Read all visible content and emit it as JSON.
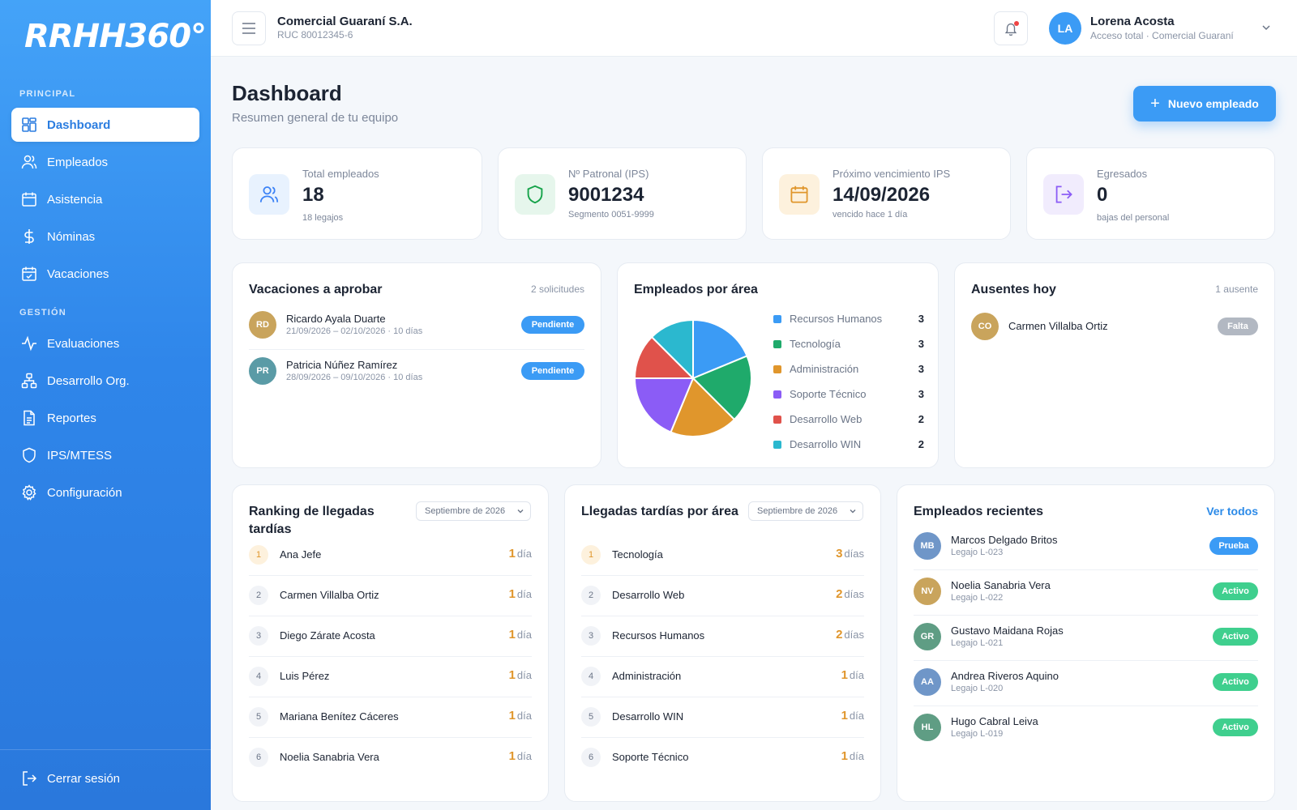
{
  "app": {
    "logo": "RRHH360°"
  },
  "sidebar": {
    "section_principal": "PRINCIPAL",
    "section_gestion": "GESTIÓN",
    "items": [
      {
        "label": "Dashboard",
        "icon": "dashboard-icon"
      },
      {
        "label": "Empleados",
        "icon": "users-icon"
      },
      {
        "label": "Asistencia",
        "icon": "calendar-icon"
      },
      {
        "label": "Nóminas",
        "icon": "dollar-icon"
      },
      {
        "label": "Vacaciones",
        "icon": "calendar-check-icon"
      },
      {
        "label": "Evaluaciones",
        "icon": "activity-icon"
      },
      {
        "label": "Desarrollo Org.",
        "icon": "org-chart-icon"
      },
      {
        "label": "Reportes",
        "icon": "document-icon"
      },
      {
        "label": "IPS/MTESS",
        "icon": "shield-icon"
      },
      {
        "label": "Configuración",
        "icon": "gear-icon"
      }
    ],
    "logout": "Cerrar sesión"
  },
  "topbar": {
    "company": "Comercial Guaraní S.A.",
    "ruc": "RUC 80012345-6",
    "user_initials": "LA",
    "user_name": "Lorena Acosta",
    "user_role": "Acceso total · Comercial Guaraní"
  },
  "header": {
    "title": "Dashboard",
    "subtitle": "Resumen general de tu equipo",
    "new_button": "Nuevo empleado"
  },
  "stats": [
    {
      "label": "Total empleados",
      "value": "18",
      "sub": "18 legajos",
      "icon": "users-icon",
      "color": "#3b82f6",
      "bg": "#e8f2fe"
    },
    {
      "label": "Nº Patronal (IPS)",
      "value": "9001234",
      "sub": "Segmento 0051-9999",
      "icon": "shield-icon",
      "color": "#16a34a",
      "bg": "#e6f6ec"
    },
    {
      "label": "Próximo vencimiento IPS",
      "value": "14/09/2026",
      "sub": "vencido hace 1 día",
      "icon": "calendar-icon",
      "color": "#e0962c",
      "bg": "#fdf1dd"
    },
    {
      "label": "Egresados",
      "value": "0",
      "sub": "bajas del personal",
      "icon": "logout-icon",
      "color": "#8b5cf6",
      "bg": "#f1ecfd"
    }
  ],
  "vacaciones": {
    "title": "Vacaciones a aprobar",
    "meta": "2 solicitudes",
    "items": [
      {
        "initials": "RD",
        "name": "Ricardo Ayala Duarte",
        "dates": "21/09/2026 – 02/10/2026 · 10 días",
        "status": "Pendiente",
        "avatar_color": "#c9a45c"
      },
      {
        "initials": "PR",
        "name": "Patricia Núñez Ramírez",
        "dates": "28/09/2026 – 09/10/2026 · 10 días",
        "status": "Pendiente",
        "avatar_color": "#5a9ba6"
      }
    ]
  },
  "areas": {
    "title": "Empleados por área"
  },
  "chart_data": {
    "type": "pie",
    "title": "Empleados por área",
    "categories": [
      "Recursos Humanos",
      "Tecnología",
      "Administración",
      "Soporte Técnico",
      "Desarrollo Web",
      "Desarrollo WIN"
    ],
    "values": [
      3,
      3,
      3,
      3,
      2,
      2
    ],
    "colors": [
      "#3b9bf5",
      "#1faa6b",
      "#e0962c",
      "#8b5cf6",
      "#e0524b",
      "#2bb8cf"
    ],
    "legend": "right"
  },
  "ausentes": {
    "title": "Ausentes hoy",
    "meta": "1 ausente",
    "items": [
      {
        "initials": "CO",
        "name": "Carmen Villalba Ortiz",
        "status": "Falta",
        "avatar_color": "#c9a45c"
      }
    ]
  },
  "ranking": {
    "title": "Ranking de llegadas tardías",
    "period": "Septiembre de 2026",
    "items": [
      {
        "n": "1",
        "name": "Ana Jefe",
        "count": "1",
        "unit": "día"
      },
      {
        "n": "2",
        "name": "Carmen Villalba Ortiz",
        "count": "1",
        "unit": "día"
      },
      {
        "n": "3",
        "name": "Diego Zárate Acosta",
        "count": "1",
        "unit": "día"
      },
      {
        "n": "4",
        "name": "Luis Pérez",
        "count": "1",
        "unit": "día"
      },
      {
        "n": "5",
        "name": "Mariana Benítez Cáceres",
        "count": "1",
        "unit": "día"
      },
      {
        "n": "6",
        "name": "Noelia Sanabria Vera",
        "count": "1",
        "unit": "día"
      }
    ]
  },
  "tardias_area": {
    "title": "Llegadas tardías por área",
    "period": "Septiembre de 2026",
    "items": [
      {
        "n": "1",
        "name": "Tecnología",
        "count": "3",
        "unit": "días"
      },
      {
        "n": "2",
        "name": "Desarrollo Web",
        "count": "2",
        "unit": "días"
      },
      {
        "n": "3",
        "name": "Recursos Humanos",
        "count": "2",
        "unit": "días"
      },
      {
        "n": "4",
        "name": "Administración",
        "count": "1",
        "unit": "día"
      },
      {
        "n": "5",
        "name": "Desarrollo WIN",
        "count": "1",
        "unit": "día"
      },
      {
        "n": "6",
        "name": "Soporte Técnico",
        "count": "1",
        "unit": "día"
      }
    ]
  },
  "recientes": {
    "title": "Empleados recientes",
    "link": "Ver todos",
    "items": [
      {
        "initials": "MB",
        "name": "Marcos Delgado Britos",
        "legajo": "Legajo L-023",
        "status": "Prueba",
        "status_color": "#3b9bf5",
        "avatar_color": "#6f96c8"
      },
      {
        "initials": "NV",
        "name": "Noelia Sanabria Vera",
        "legajo": "Legajo L-022",
        "status": "Activo",
        "status_color": "#3fcf8e",
        "avatar_color": "#c9a45c"
      },
      {
        "initials": "GR",
        "name": "Gustavo Maidana Rojas",
        "legajo": "Legajo L-021",
        "status": "Activo",
        "status_color": "#3fcf8e",
        "avatar_color": "#5f9d84"
      },
      {
        "initials": "AA",
        "name": "Andrea Riveros Aquino",
        "legajo": "Legajo L-020",
        "status": "Activo",
        "status_color": "#3fcf8e",
        "avatar_color": "#6f96c8"
      },
      {
        "initials": "HL",
        "name": "Hugo Cabral Leiva",
        "legajo": "Legajo L-019",
        "status": "Activo",
        "status_color": "#3fcf8e",
        "avatar_color": "#5f9d84"
      }
    ]
  },
  "colors": {
    "accent": "#3b9bf5",
    "warning": "#e0962c"
  }
}
